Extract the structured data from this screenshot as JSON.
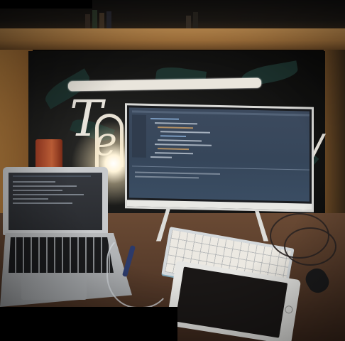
{
  "scene": {
    "description_kind": "photo",
    "colors": {
      "wood": "#b8803f",
      "desk": "#5a3e2c",
      "monitor_screen": "#3c4a5e",
      "lamp_light": "#fff4d9",
      "keyboard_accent": "#7fa7b8"
    },
    "icons": [
      "desk-lamp-icon",
      "monitor-icon",
      "laptop-icon",
      "keyboard-icon",
      "tablet-icon",
      "mouse-icon"
    ]
  }
}
